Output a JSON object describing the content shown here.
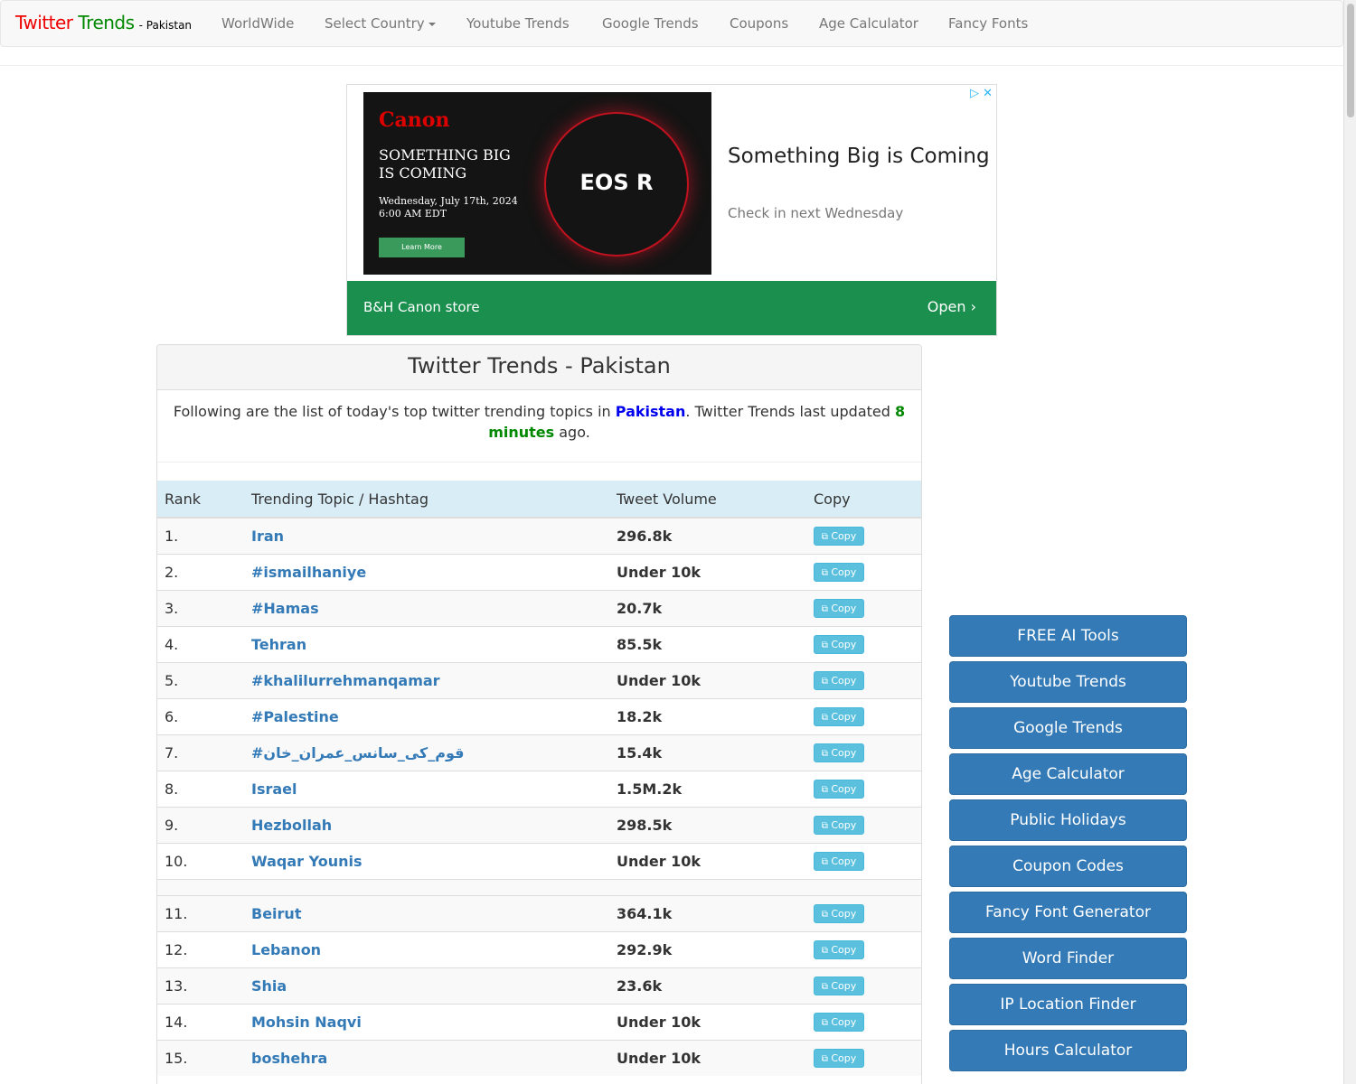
{
  "navbar": {
    "brand_red": "Twitter",
    "brand_green": "Trends",
    "brand_sub": "- Pakistan",
    "items": [
      "WorldWide",
      "Select Country",
      "Youtube Trends",
      "Google Trends",
      "Coupons",
      "Age Calculator",
      "Fancy Fonts"
    ]
  },
  "ad": {
    "image": {
      "logo": "Canon",
      "headline": "SOMETHING BIG IS COMING",
      "date": "Wednesday, July 17th, 2024",
      "time": "6:00 AM EDT",
      "button": "Learn More",
      "model": "EOS R"
    },
    "headline": "Something Big is Coming",
    "description": "Check in next Wednesday",
    "store": "B&H Canon store",
    "open": "Open"
  },
  "panel": {
    "title": "Twitter Trends - Pakistan",
    "intro_prefix": "Following are the list of today's top twitter trending topics in",
    "country": "Pakistan",
    "intro_mid": ". Twitter Trends last updated",
    "updated": "8 minutes",
    "intro_suffix": "ago."
  },
  "table": {
    "headers": [
      "Rank",
      "Trending Topic / Hashtag",
      "Tweet Volume",
      "Copy"
    ],
    "copy_label": "Copy",
    "rows": [
      {
        "rank": "1.",
        "topic": "Iran",
        "volume": "296.8k"
      },
      {
        "rank": "2.",
        "topic": "#ismailhaniye",
        "volume": "Under 10k"
      },
      {
        "rank": "3.",
        "topic": "#Hamas",
        "volume": "20.7k"
      },
      {
        "rank": "4.",
        "topic": "Tehran",
        "volume": "85.5k"
      },
      {
        "rank": "5.",
        "topic": "#khalilurrehmanqamar",
        "volume": "Under 10k"
      },
      {
        "rank": "6.",
        "topic": "#Palestine",
        "volume": "18.2k"
      },
      {
        "rank": "7.",
        "topic": "#قوم_کی_سانس_عمران_خان",
        "volume": "15.4k"
      },
      {
        "rank": "8.",
        "topic": "Israel",
        "volume": "1.5M.2k"
      },
      {
        "rank": "9.",
        "topic": "Hezbollah",
        "volume": "298.5k"
      },
      {
        "rank": "10.",
        "topic": "Waqar Younis",
        "volume": "Under 10k"
      },
      {
        "rank": "11.",
        "topic": "Beirut",
        "volume": "364.1k"
      },
      {
        "rank": "12.",
        "topic": "Lebanon",
        "volume": "292.9k"
      },
      {
        "rank": "13.",
        "topic": "Shia",
        "volume": "23.6k"
      },
      {
        "rank": "14.",
        "topic": "Mohsin Naqvi",
        "volume": "Under 10k"
      },
      {
        "rank": "15.",
        "topic": "boshehra",
        "volume": "Under 10k"
      }
    ]
  },
  "sidebar": {
    "buttons": [
      "FREE AI Tools",
      "Youtube Trends",
      "Google Trends",
      "Age Calculator",
      "Public Holidays",
      "Coupon Codes",
      "Fancy Font Generator",
      "Word Finder",
      "IP Location Finder",
      "Hours Calculator"
    ]
  },
  "colors": {
    "brand_red": "#ee0000",
    "brand_green": "#008800",
    "link": "#337ab7",
    "sidebar_button": "#337ab7",
    "copy_button": "#5bc0de",
    "table_header": "#d9edf7",
    "ad_bar": "#1b8f4e"
  }
}
